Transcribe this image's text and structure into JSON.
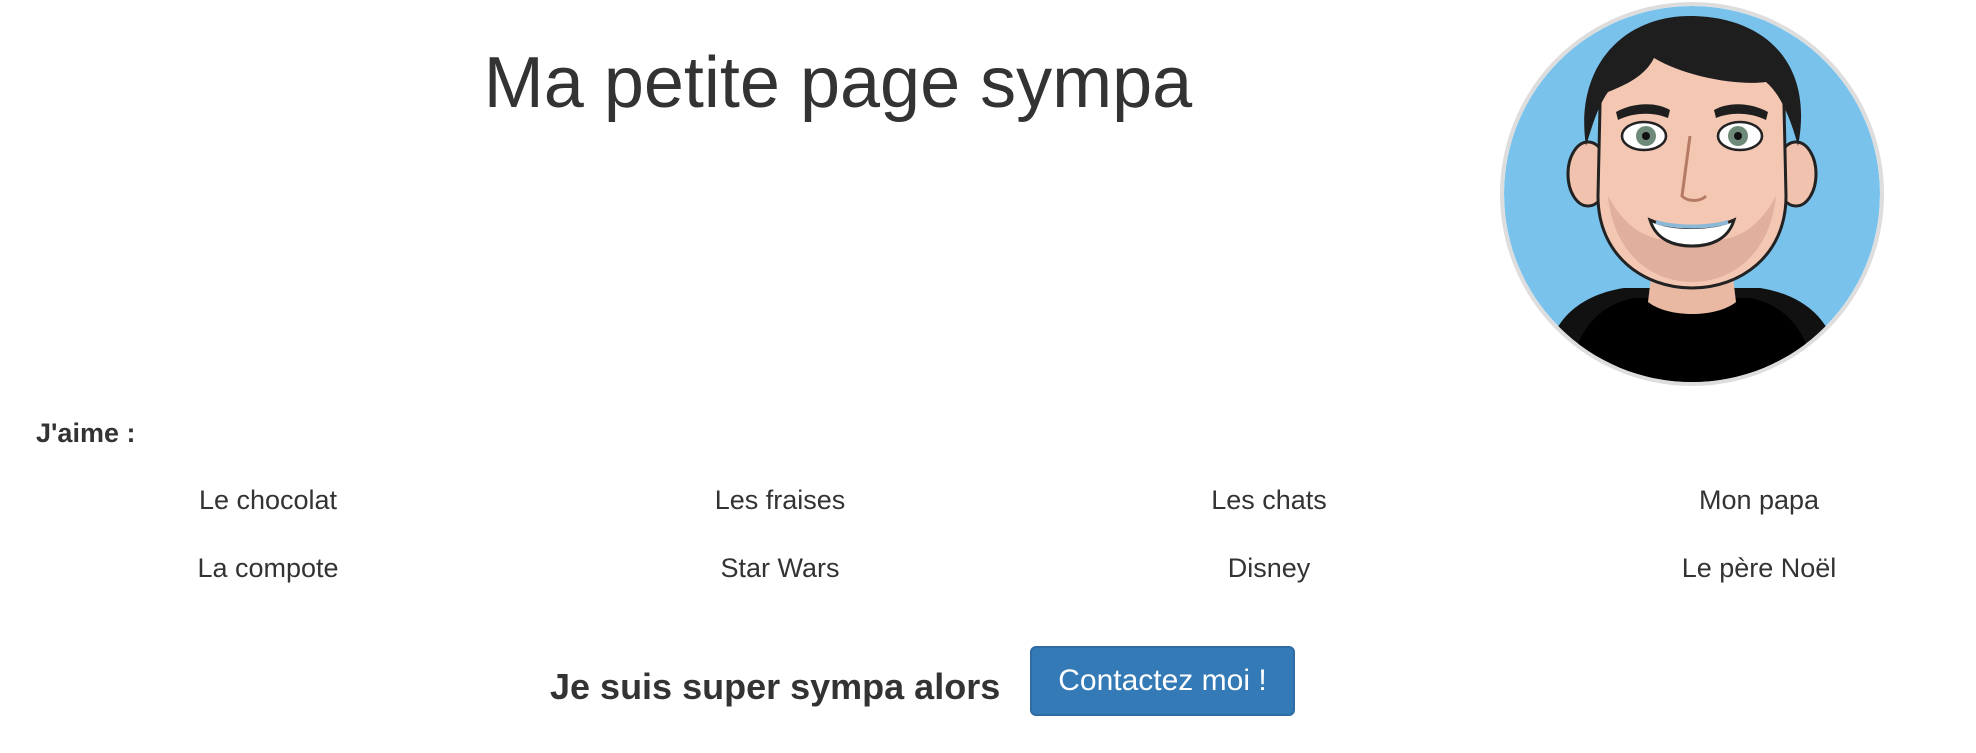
{
  "header": {
    "title": "Ma petite page sympa"
  },
  "avatar": {
    "icon": "cartoon-portrait-avatar",
    "background_color": "#78c2ec"
  },
  "likes": {
    "heading": "J'aime :",
    "items": [
      "Le chocolat",
      "Les fraises",
      "Les chats",
      "Mon papa",
      "La compote",
      "Star Wars",
      "Disney",
      "Le père Noël"
    ]
  },
  "cta": {
    "text": "Je suis super sympa alors",
    "button_label": "Contactez moi !",
    "button_color": "#337ab7"
  }
}
